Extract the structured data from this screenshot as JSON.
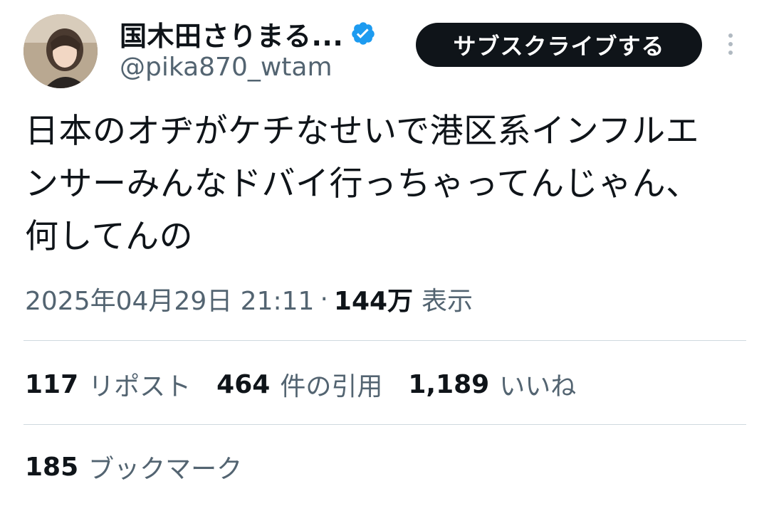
{
  "author": {
    "display_name": "国木田さりまる...",
    "handle": "@pika870_wtam",
    "verified": true,
    "verified_color": "#1d9bf0"
  },
  "actions": {
    "subscribe_label": "サブスクライブする",
    "more_icon": "more-vertical-icon"
  },
  "tweet": {
    "lines": [
      "日本のオヂがケチなせいで港区系インフルエ",
      "ンサーみんなドバイ行っちゃってんじゃん、",
      "何してんの"
    ]
  },
  "meta": {
    "timestamp": "2025年04月29日 21:11",
    "separator": "·",
    "views_count": "144万",
    "views_label": "表示"
  },
  "stats": [
    {
      "count": "117",
      "label": "リポスト"
    },
    {
      "count": "464",
      "label": "件の引用"
    },
    {
      "count": "1,189",
      "label": "いいね"
    }
  ],
  "bookmarks": {
    "count": "185",
    "label": "ブックマーク"
  },
  "colors": {
    "text_primary": "#0f1419",
    "text_secondary": "#536471",
    "divider": "#cfd9de",
    "button_bg": "#0f1419"
  }
}
